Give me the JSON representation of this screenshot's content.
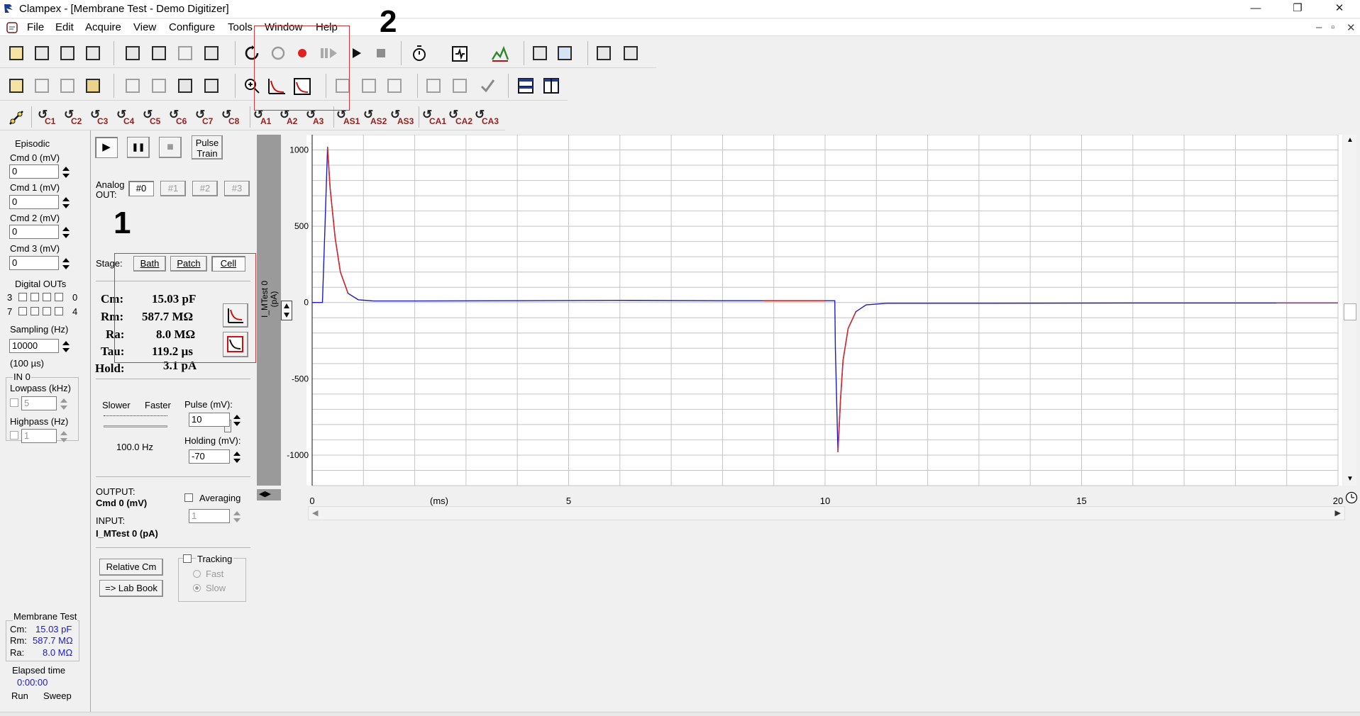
{
  "title_bar": {
    "title": "Clampex - [Membrane Test - Demo Digitizer]",
    "minimize": "—",
    "restore": "❐",
    "close": "✕"
  },
  "menu": [
    "File",
    "Edit",
    "Acquire",
    "View",
    "Configure",
    "Tools",
    "Window",
    "Help"
  ],
  "mdi": {
    "min": "–",
    "restore": "▫",
    "close": "✕"
  },
  "macros_c": [
    "C1",
    "C2",
    "C3",
    "C4",
    "C5",
    "C6",
    "C7",
    "C8"
  ],
  "macros_a": [
    "A1",
    "A2",
    "A3",
    "AS1",
    "AS2",
    "AS3",
    "CA1",
    "CA2",
    "CA3"
  ],
  "left": {
    "mode": "Episodic",
    "cmds": [
      {
        "label": "Cmd 0 (mV)",
        "value": "0"
      },
      {
        "label": "Cmd 1 (mV)",
        "value": "0"
      },
      {
        "label": "Cmd 2 (mV)",
        "value": "0"
      },
      {
        "label": "Cmd 3 (mV)",
        "value": "0"
      }
    ],
    "digital_outs": "Digital OUTs",
    "d_row1_left": "3",
    "d_row1_right": "0",
    "d_row2_left": "7",
    "d_row2_right": "4",
    "sampling_label": "Sampling (Hz)",
    "sampling_value": "10000",
    "interval": "(100 µs)",
    "in_group": "IN 0",
    "lowpass_label": "Lowpass (kHz)",
    "lowpass_value": "5",
    "highpass_label": "Highpass (Hz)",
    "highpass_value": "1",
    "mt_title": "Membrane Test",
    "mt_cm_label": "Cm:",
    "mt_cm": "15.03 pF",
    "mt_rm_label": "Rm:",
    "mt_rm": "587.7 MΩ",
    "mt_ra_label": "Ra:",
    "mt_ra": "8.0 MΩ",
    "elapsed_label": "Elapsed time",
    "elapsed_value": "0:00:00",
    "run": "Run",
    "sweep": "Sweep"
  },
  "mt": {
    "play": "▶",
    "pause": "❚❚",
    "stop": "■",
    "pulse_train": "Pulse\nTrain",
    "analog_out": "Analog\nOUT:",
    "ao": [
      "#0",
      "#1",
      "#2",
      "#3"
    ],
    "stage_label": "Stage:",
    "stages": [
      "Bath",
      "Patch",
      "Cell"
    ],
    "results": [
      {
        "label": "Cm:",
        "value": "15.03 pF"
      },
      {
        "label": "Rm:",
        "value": "587.7 MΩ"
      },
      {
        "label": "Ra:",
        "value": "8.0 MΩ"
      },
      {
        "label": "Tau:",
        "value": "119.2 µs"
      },
      {
        "label": "Hold:",
        "value": "3.1 pA"
      }
    ],
    "slower": "Slower",
    "faster": "Faster",
    "rate": "100.0 Hz",
    "slider_fraction": 0.5,
    "pulse_label": "Pulse (mV):",
    "pulse_value": "10",
    "holding_label": "Holding (mV):",
    "holding_value": "-70",
    "output_label": "OUTPUT:",
    "output_value": "Cmd 0 (mV)",
    "averaging": "Averaging",
    "avg_value": "1",
    "input_label": "INPUT:",
    "input_value": "I_MTest 0 (pA)",
    "relative_cm": "Relative Cm",
    "lab_book": "=> Lab Book",
    "tracking": "Tracking",
    "fast": "Fast",
    "slow": "Slow"
  },
  "annotations": {
    "one": "1",
    "two": "2"
  },
  "chart_data": {
    "type": "line",
    "ylabel": "I_MTest 0\n(pA)",
    "xunit": "(ms)",
    "xlim": [
      0,
      20
    ],
    "ylim": [
      -1200,
      1100
    ],
    "xticks": [
      0,
      5,
      10,
      15,
      20
    ],
    "yticks": [
      -1000,
      -500,
      0,
      500,
      1000
    ],
    "grid": true,
    "series": [
      {
        "x": [
          0,
          0.2,
          0.25,
          0.3,
          0.35,
          0.45,
          0.55,
          0.7,
          0.9,
          1.2,
          2,
          4,
          6,
          8,
          10,
          10.19,
          10.2,
          10.25,
          10.3,
          10.35,
          10.45,
          10.6,
          10.8,
          11.2,
          13,
          16,
          20
        ],
        "y": [
          0,
          0,
          500,
          1020,
          750,
          420,
          200,
          60,
          18,
          10,
          10,
          12,
          14,
          12,
          12,
          12,
          -300,
          -980,
          -640,
          -380,
          -170,
          -60,
          -15,
          -5,
          -5,
          -3,
          -3
        ]
      }
    ],
    "colors": {
      "trace": "#1a1acc",
      "fit": "#d42a2a",
      "grid": "#c4c4c4"
    }
  }
}
